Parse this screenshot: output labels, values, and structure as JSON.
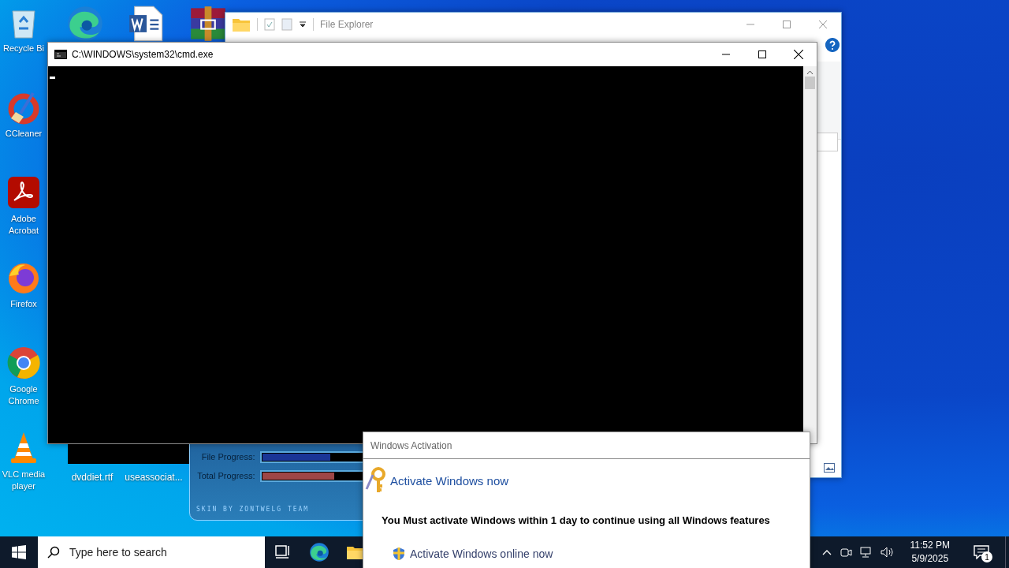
{
  "desktop_icons": [
    {
      "label": "Recycle Bi",
      "kind": "recycle"
    },
    {
      "label": "CCleaner",
      "kind": "ccleaner"
    },
    {
      "label": "Adobe Acrobat",
      "kind": "acrobat"
    },
    {
      "label": "Firefox",
      "kind": "firefox"
    },
    {
      "label": "Google Chrome",
      "kind": "chrome"
    },
    {
      "label": "VLC media player",
      "kind": "vlc"
    }
  ],
  "desktop_top_icons": [
    {
      "kind": "edge"
    },
    {
      "kind": "word"
    },
    {
      "kind": "winrar"
    }
  ],
  "desktop_files": [
    {
      "label": "dvddiet.rtf"
    },
    {
      "label": "useassociat..."
    }
  ],
  "file_explorer": {
    "title": "File Explorer"
  },
  "cmd_window": {
    "title": "C:\\WINDOWS\\system32\\cmd.exe"
  },
  "installer": {
    "progress": [
      {
        "label": "File Progress:",
        "level": 0.6,
        "color": "#1a3596"
      },
      {
        "label": "Total Progress:",
        "level": 0.64,
        "color": "#9e4646"
      }
    ],
    "credit": "SKIN BY ZONTWELG TEAM"
  },
  "activation_dialog": {
    "title": "Windows Activation",
    "heading": "Activate Windows now",
    "message": "You Must activate Windows within 1 day to continue using all Windows features",
    "link": "Activate Windows online now"
  },
  "taskbar": {
    "search_placeholder": "Type here to search",
    "apps": [
      {
        "kind": "taskview"
      },
      {
        "kind": "edge"
      },
      {
        "kind": "explorer"
      }
    ],
    "time": "11:52 PM",
    "date": "5/9/2025",
    "notification_count": "1"
  }
}
